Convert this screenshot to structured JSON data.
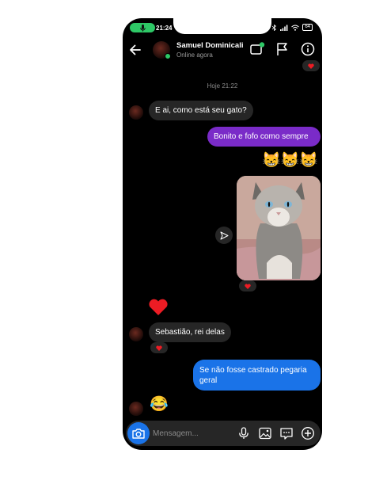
{
  "status_bar": {
    "time": "21:24",
    "battery": "64"
  },
  "header": {
    "name": "Samuel Dominicali",
    "status": "Online agora"
  },
  "date_divider": "Hoje 21:22",
  "messages": {
    "m1": "E ai, como está seu gato?",
    "m2": "Bonito e fofo como sempre",
    "m3": "😸😸😸",
    "m5": "Sebastião, rei delas",
    "m6": "Se não fosse castrado pegaria geral",
    "m7": "😂"
  },
  "input": {
    "placeholder": "Mensagem..."
  },
  "colors": {
    "accent_blue": "#1a73e8",
    "purple": "#7a2bc8",
    "online": "#2ec866",
    "heart": "#ed1c24"
  }
}
